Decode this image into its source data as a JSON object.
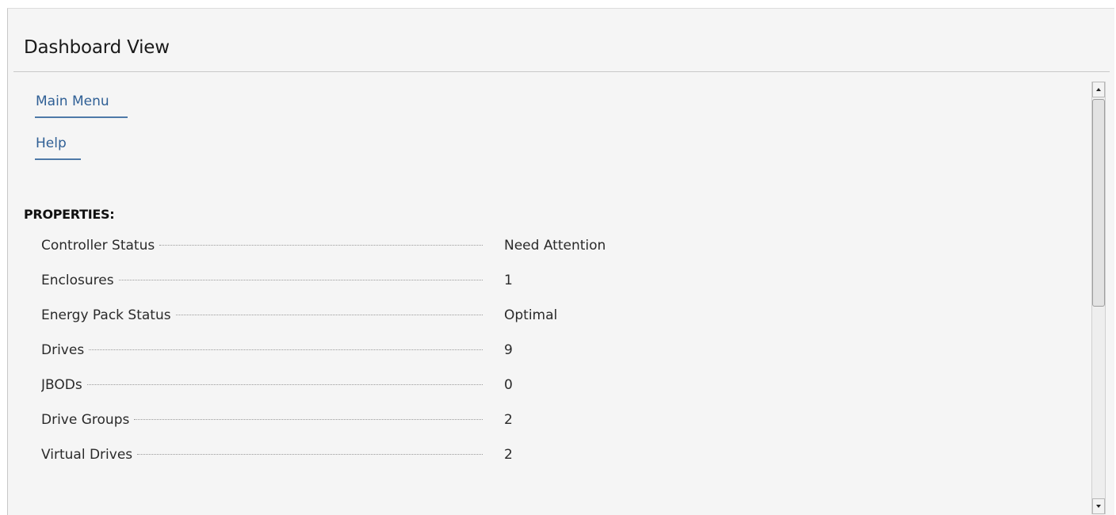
{
  "header": {
    "title": "Dashboard View"
  },
  "nav": {
    "main_menu": "Main Menu",
    "help": "Help"
  },
  "properties": {
    "heading": "PROPERTIES:",
    "rows": [
      {
        "label": "Controller Status",
        "value": "Need Attention"
      },
      {
        "label": "Enclosures",
        "value": "1"
      },
      {
        "label": "Energy Pack Status",
        "value": "Optimal"
      },
      {
        "label": "Drives",
        "value": "9"
      },
      {
        "label": "JBODs",
        "value": "0"
      },
      {
        "label": "Drive Groups",
        "value": "2"
      },
      {
        "label": "Virtual Drives",
        "value": "2"
      }
    ]
  },
  "scrollbar": {
    "icons": {
      "up": "arrow-up-icon",
      "down": "arrow-down-icon"
    },
    "position_fraction": 0.0
  },
  "colors": {
    "link": "#2f5f95",
    "background": "#f5f5f5"
  }
}
